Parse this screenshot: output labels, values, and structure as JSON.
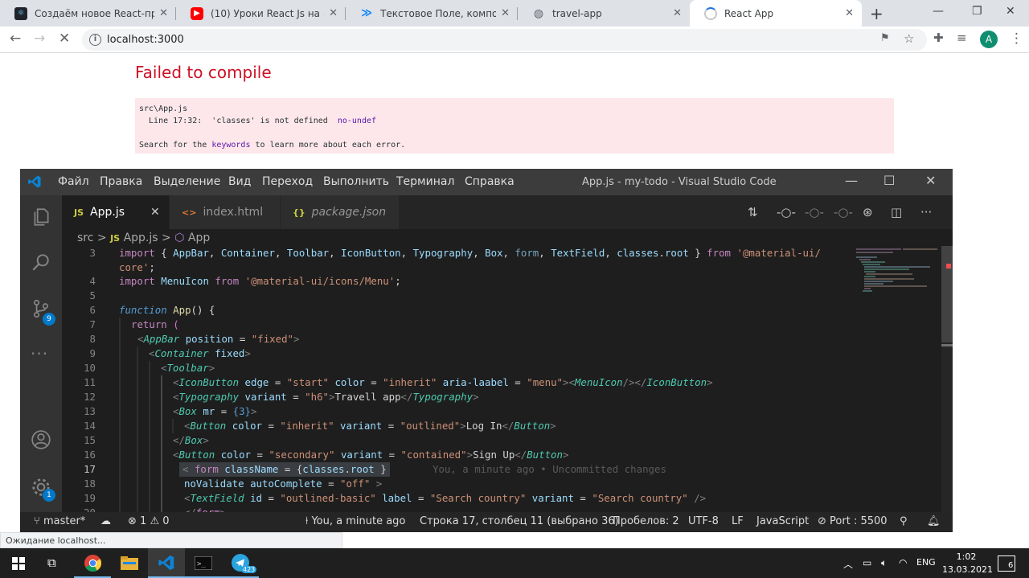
{
  "browser": {
    "tabs": [
      {
        "title": "Создаём новое React-прилож",
        "favicon": "react-icon"
      },
      {
        "title": "(10) Уроки React Js на практи",
        "favicon": "youtube-icon"
      },
      {
        "title": "Текстовое Поле, компонент R",
        "favicon": "mui-icon"
      },
      {
        "title": "travel-app",
        "favicon": "globe-icon"
      },
      {
        "title": "React App",
        "favicon": "loading-icon"
      }
    ],
    "url": "localhost:3000",
    "avatar_letter": "A",
    "status_text": "Ожидание localhost..."
  },
  "page": {
    "error_title": "Failed to compile",
    "file": "src\\App.js",
    "error_line": "  Line 17:32:  'classes' is not defined  ",
    "rule": "no-undef",
    "help_prefix": "Search for the ",
    "help_link": "keywords",
    "help_suffix": " to learn more about each error."
  },
  "vscode": {
    "menu": [
      "Файл",
      "Правка",
      "Выделение",
      "Вид",
      "Переход",
      "Выполнить",
      "Терминал",
      "Справка"
    ],
    "window_title": "App.js - my-todo - Visual Studio Code",
    "tabs": [
      {
        "icon": "JS",
        "label": "App.js"
      },
      {
        "icon": "<>",
        "label": "index.html"
      },
      {
        "icon": "{}",
        "label": "package.json"
      }
    ],
    "breadcrumb": {
      "folder": "src",
      "file_icon": "JS",
      "file": "App.js",
      "symbol": "App"
    },
    "activity_badges": {
      "scm": "9",
      "settings": "1"
    },
    "line_numbers": [
      "3",
      "",
      "4",
      "5",
      "6",
      "7",
      "8",
      "9",
      "10",
      "11",
      "12",
      "13",
      "14",
      "15",
      "16",
      "17",
      "18",
      "19",
      "20"
    ],
    "blame": "You, a minute ago • Uncommitted changes",
    "status": {
      "branch": "master*",
      "errors": "1",
      "warnings": "0",
      "author": "You, a minute ago",
      "cursor": "Строка 17, столбец 11 (выбрано 36)",
      "spaces": "Пробелов: 2",
      "encoding": "UTF-8",
      "eol": "LF",
      "language": "JavaScript",
      "port": "Port : 5500"
    }
  },
  "taskbar": {
    "lang": "ENG",
    "time": "1:02",
    "date": "13.03.2021",
    "notifications": "6",
    "telegram_badge": "423"
  },
  "colors": {
    "error_red": "#ce1126",
    "error_bg": "#fde7ea",
    "vscode_accent": "#007acc"
  }
}
